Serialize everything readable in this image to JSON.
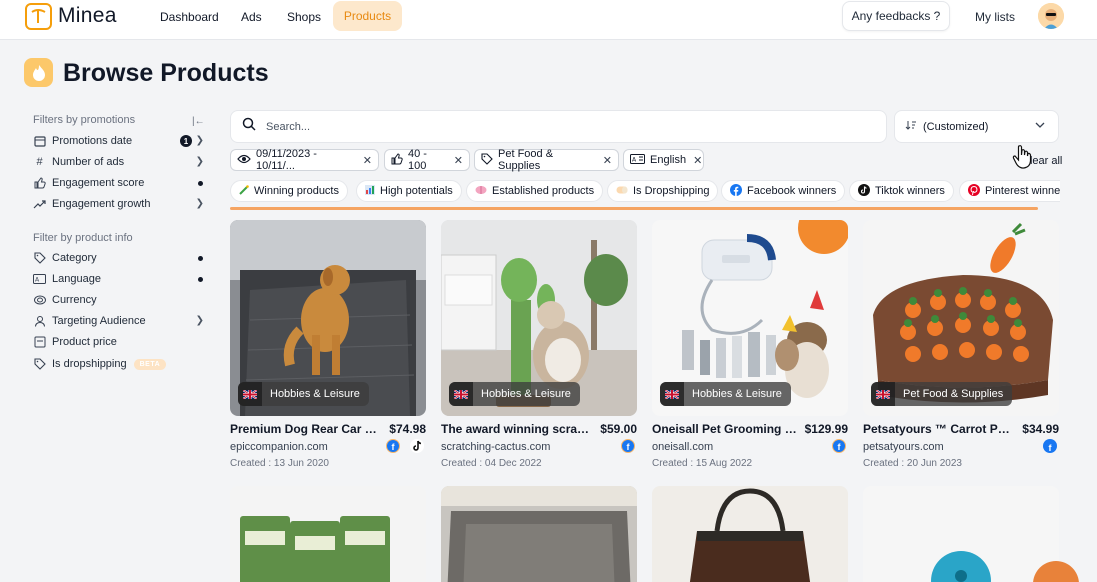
{
  "app": {
    "name": "Minea"
  },
  "nav": {
    "items": [
      {
        "label": "Dashboard"
      },
      {
        "label": "Ads"
      },
      {
        "label": "Shops"
      },
      {
        "label": "Products"
      }
    ],
    "feedback": "Any feedbacks ?",
    "my_lists": "My lists"
  },
  "page": {
    "title": "Browse Products"
  },
  "sidebar": {
    "section1": "Filters by promotions",
    "promotions": [
      {
        "label": "Promotions date",
        "icon": "calendar-icon",
        "badge": "1"
      },
      {
        "label": "Number of ads",
        "icon": "hash-icon"
      },
      {
        "label": "Engagement score",
        "icon": "thumbs-up-icon"
      },
      {
        "label": "Engagement growth",
        "icon": "trending-up-icon"
      }
    ],
    "section2": "Filter by product info",
    "product_info": [
      {
        "label": "Category",
        "icon": "tag-icon"
      },
      {
        "label": "Language",
        "icon": "language-icon"
      },
      {
        "label": "Currency",
        "icon": "currency-icon"
      },
      {
        "label": "Targeting Audience",
        "icon": "user-icon"
      },
      {
        "label": "Product price",
        "icon": "price-icon"
      },
      {
        "label": "Is dropshipping",
        "icon": "tag-icon",
        "badge": "BETA"
      }
    ]
  },
  "search": {
    "placeholder": "Search...",
    "value": ""
  },
  "sort": {
    "label": "(Customized)"
  },
  "active_filters": [
    {
      "label": "09/11/2023 - 10/11/...",
      "icon": "eye-icon"
    },
    {
      "label": "40 - 100",
      "icon": "thumbs-up-icon"
    },
    {
      "label": "Pet Food & Supplies",
      "icon": "tag-icon"
    },
    {
      "label": "English",
      "icon": "language-icon"
    }
  ],
  "clear_all": "Clear all",
  "tags": [
    {
      "label": "Winning products",
      "icon": "wand-icon"
    },
    {
      "label": "High potentials",
      "icon": "chart-icon"
    },
    {
      "label": "Established products",
      "icon": "brain-icon"
    },
    {
      "label": "Is Dropshipping",
      "icon": "pill-icon"
    },
    {
      "label": "Facebook winners",
      "icon": "facebook-icon"
    },
    {
      "label": "Tiktok winners",
      "icon": "tiktok-icon"
    },
    {
      "label": "Pinterest winners",
      "icon": "pinterest-icon"
    }
  ],
  "products": [
    {
      "category": "Hobbies & Leisure",
      "title": "Premium Dog Rear Car S...",
      "price": "$74.98",
      "domain": "epiccompanion.com",
      "created": "Created : 13 Jun 2020",
      "socials": [
        "facebook",
        "tiktok"
      ]
    },
    {
      "category": "Hobbies & Leisure",
      "title": "The award winning scrat...",
      "price": "$59.00",
      "domain": "scratching-cactus.com",
      "created": "Created : 04 Dec 2022",
      "socials": [
        "facebook"
      ]
    },
    {
      "category": "Hobbies & Leisure",
      "title": "Oneisall Pet Grooming K...",
      "price": "$129.99",
      "domain": "oneisall.com",
      "created": "Created : 15 Aug 2022",
      "socials": [
        "facebook"
      ]
    },
    {
      "category": "Pet Food & Supplies",
      "title": "Petsatyours ™ Carrot Plu...",
      "price": "$34.99",
      "domain": "petsatyours.com",
      "created": "Created : 20 Jun 2023",
      "socials": [
        "facebook"
      ]
    }
  ],
  "colors": {
    "accent": "#e88a12",
    "active_bg": "#fde8cc",
    "progress": "#f5a462"
  }
}
